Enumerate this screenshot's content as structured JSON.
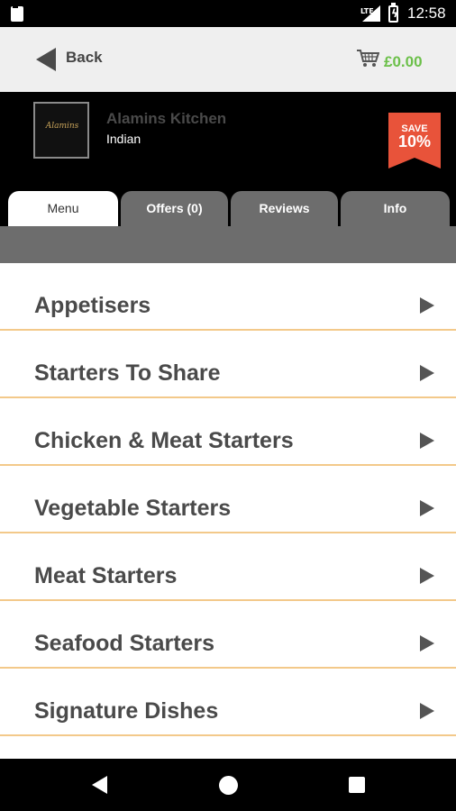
{
  "status_bar": {
    "network": "LTE",
    "time": "12:58"
  },
  "nav": {
    "back_label": "Back",
    "cart_total": "£0.00"
  },
  "restaurant": {
    "logo_text": "Alamins",
    "name": "Alamins Kitchen",
    "cuisine": "Indian",
    "badge_line1": "SAVE",
    "badge_line2": "10%"
  },
  "tabs": [
    {
      "label": "Menu",
      "active": true
    },
    {
      "label": "Offers (0)",
      "active": false
    },
    {
      "label": "Reviews",
      "active": false
    },
    {
      "label": "Info",
      "active": false
    }
  ],
  "menu": {
    "categories": [
      {
        "label": "Appetisers"
      },
      {
        "label": "Starters To Share"
      },
      {
        "label": "Chicken & Meat Starters"
      },
      {
        "label": "Vegetable Starters"
      },
      {
        "label": "Meat Starters"
      },
      {
        "label": "Seafood Starters"
      },
      {
        "label": "Signature Dishes"
      }
    ]
  },
  "colors": {
    "accent_green": "#6cc04a",
    "badge_red": "#e8533a",
    "divider_orange": "#f3c98a",
    "tab_grey": "#6d6d6d"
  },
  "icons": {
    "status_left": "sd-card-icon",
    "status_signal": "signal-icon",
    "status_battery": "battery-charging-icon",
    "back": "back-arrow-icon",
    "cart": "cart-icon",
    "row_chevron": "chevron-right-icon",
    "nav_back": "nav-back-icon",
    "nav_home": "nav-home-icon",
    "nav_recents": "nav-recents-icon"
  }
}
